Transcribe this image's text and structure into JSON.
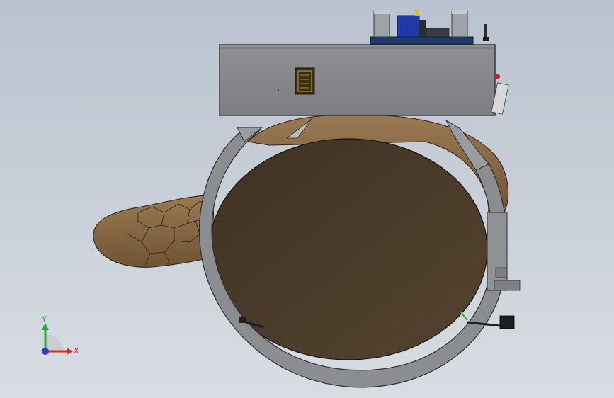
{
  "viewport": {
    "background_top": "#b9c2cf",
    "background_bottom": "#d9dde3"
  },
  "model": {
    "colors": {
      "housing": "#85878a",
      "housing_edge": "#3b3d40",
      "ring": "#8b8d90",
      "wood_bark": "#8a6a45",
      "wood_face": "#4a3a2a",
      "pcb": "#1f3b6b",
      "connector": "#c8a63a"
    },
    "icons": {
      "log": "wood-log-icon",
      "housing": "control-box-icon",
      "clamp": "clamp-ring-icon",
      "board": "circuit-board-icon"
    }
  },
  "triad": {
    "x_label": "X",
    "y_label": "Y",
    "x_color": "#d0302a",
    "y_color": "#2aa93a",
    "z_color": "#2a3fd0"
  }
}
